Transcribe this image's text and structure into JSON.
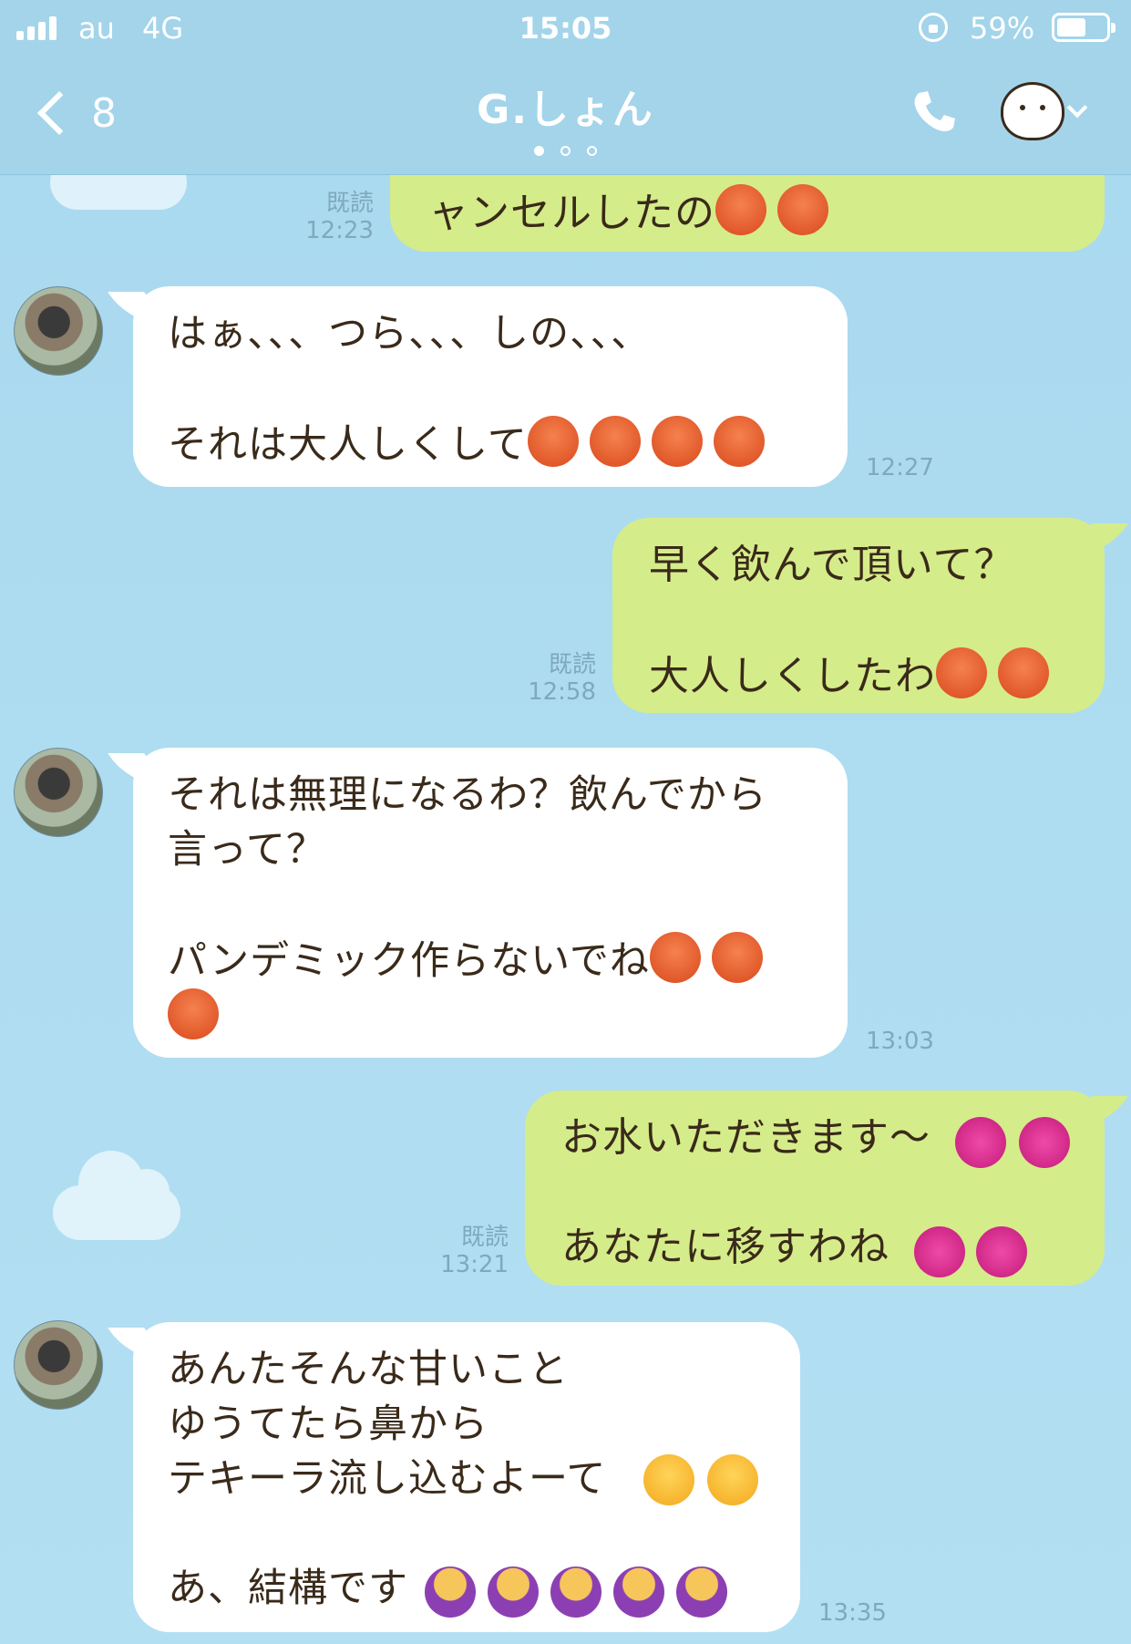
{
  "status_bar": {
    "carrier": "au",
    "network": "4G",
    "time": "15:05",
    "battery": "59%",
    "battery_level": 0.59
  },
  "header": {
    "back_count": "8",
    "title": "G.しょん",
    "page_index": 0,
    "page_count": 3,
    "icons": [
      "chevron-left-icon",
      "phone-icon",
      "sticker-menu-icon",
      "chevron-down-icon"
    ]
  },
  "colors": {
    "header_bg": "#a3d4ea",
    "chat_bg": "#a7d8ee",
    "incoming_bubble": "#ffffff",
    "outgoing_bubble": "#d5ec8a",
    "text": "#3a2a1a",
    "meta_text": "#7fa9bd"
  },
  "messages": [
    {
      "direction": "out",
      "text": "ャンセルしたの",
      "emojis": [
        "pouting-face",
        "pouting-face"
      ],
      "read": "既読",
      "time": "12:23"
    },
    {
      "direction": "in",
      "text": "はぁ、、、つら、、、しの、、、\n\nそれは大人しくして",
      "emojis": [
        "pouting-face",
        "pouting-face",
        "pouting-face",
        "pouting-face"
      ],
      "time": "12:27"
    },
    {
      "direction": "out",
      "text": "早く飲んで頂いて？\n\n大人しくしたわ",
      "emojis": [
        "pouting-face",
        "pouting-face"
      ],
      "read": "既読",
      "time": "12:58"
    },
    {
      "direction": "in",
      "text": "それは無理になるわ？飲んでから\n言って？\n\nパンデミック作らないでね",
      "emojis": [
        "pouting-face",
        "pouting-face",
        "pouting-face"
      ],
      "time": "13:03"
    },
    {
      "direction": "out",
      "text": "お水いただきます〜\n\nあなたに移すわね",
      "emojis": [
        "two-hearts",
        "two-hearts",
        "two-hearts",
        "two-hearts"
      ],
      "read": "既読",
      "time": "13:21"
    },
    {
      "direction": "in",
      "text": "あんたそんな甘いこと\nゆうてたら鼻から\nテキーラ流し込むよーて\n\nあ、結構です",
      "emojis": [
        "kissing-heart",
        "kissing-heart",
        "tipping-hand",
        "tipping-hand",
        "tipping-hand",
        "tipping-hand",
        "tipping-hand"
      ],
      "time": "13:35"
    }
  ]
}
